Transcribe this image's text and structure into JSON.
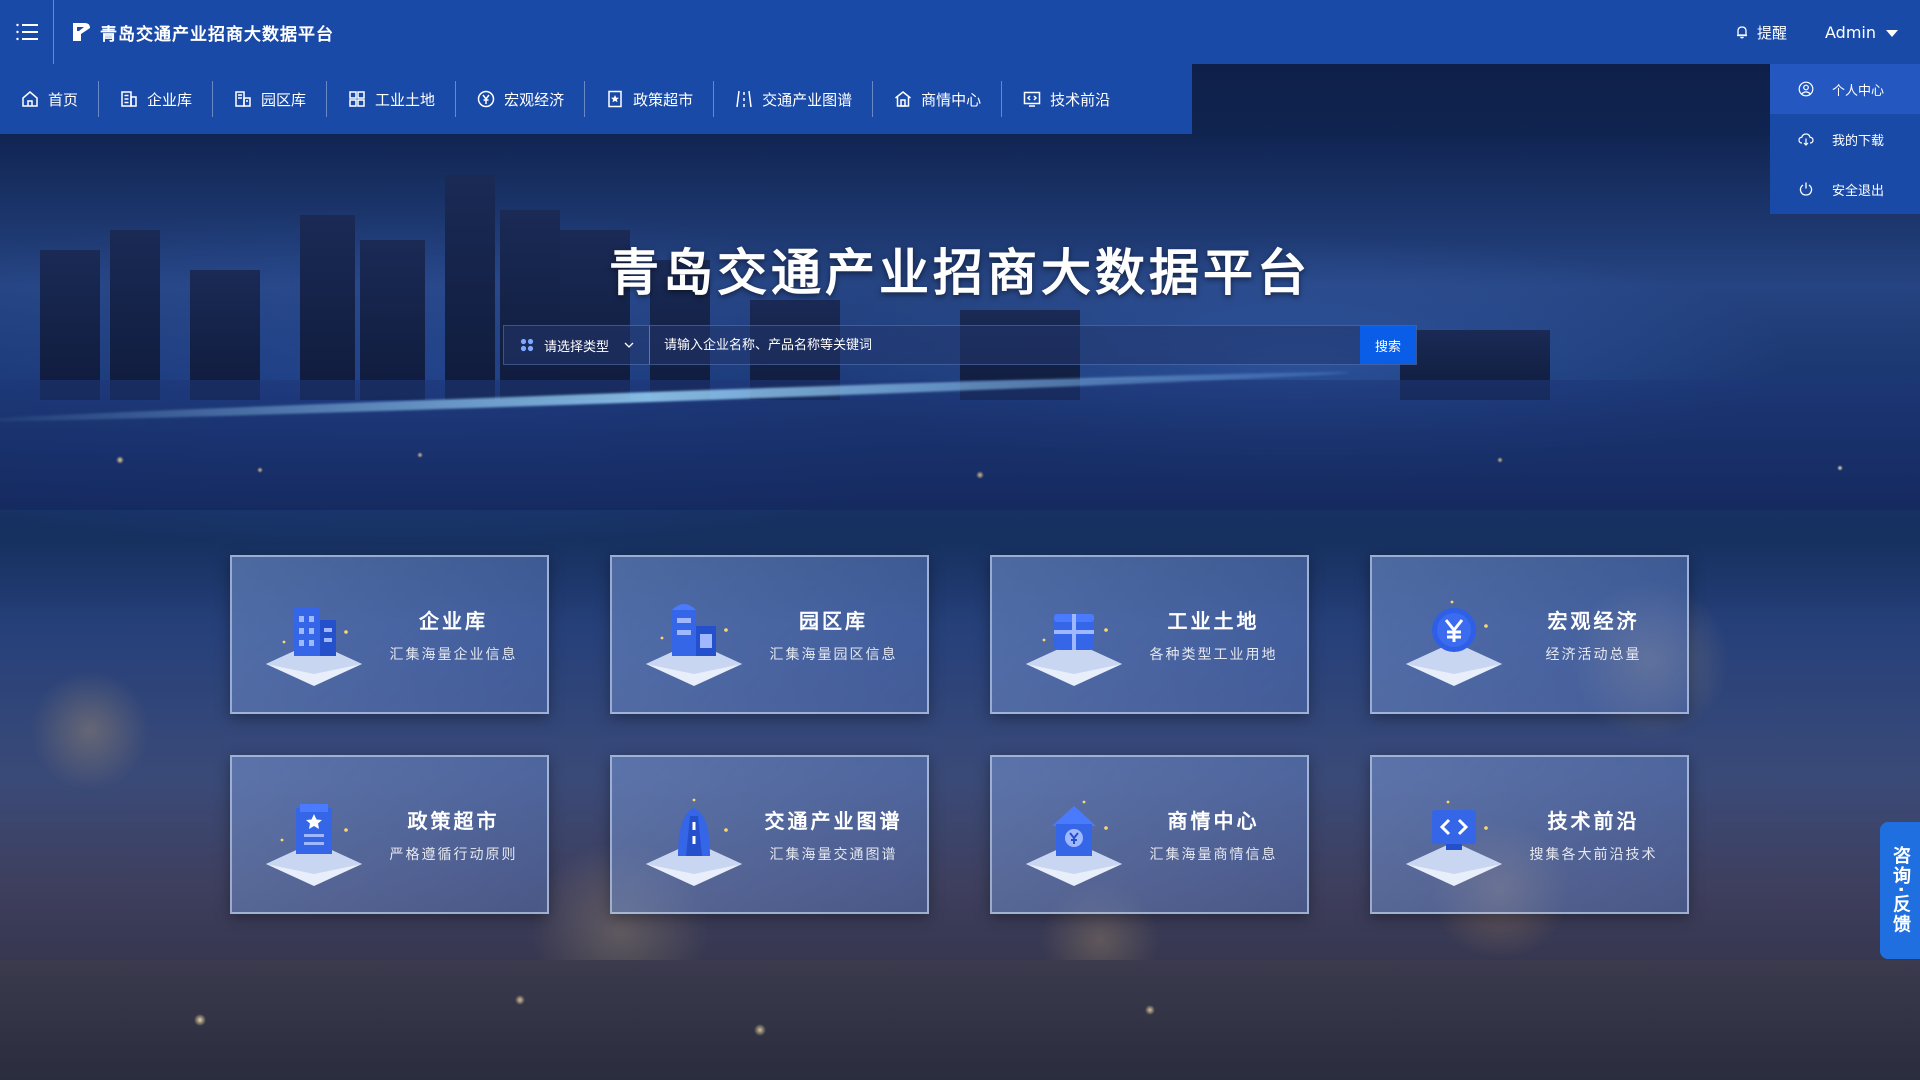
{
  "header": {
    "title": "青岛交通产业招商大数据平台",
    "alert_label": "提醒",
    "user_name": "Admin"
  },
  "nav": {
    "items": [
      {
        "label": "首页",
        "icon": "home-icon"
      },
      {
        "label": "企业库",
        "icon": "building-icon"
      },
      {
        "label": "园区库",
        "icon": "park-icon"
      },
      {
        "label": "工业土地",
        "icon": "grid-icon"
      },
      {
        "label": "宏观经济",
        "icon": "yen-circle-icon"
      },
      {
        "label": "政策超市",
        "icon": "star-doc-icon"
      },
      {
        "label": "交通产业图谱",
        "icon": "road-icon"
      },
      {
        "label": "商情中心",
        "icon": "house-icon"
      },
      {
        "label": "技术前沿",
        "icon": "code-screen-icon"
      }
    ]
  },
  "user_menu": {
    "items": [
      {
        "label": "个人中心",
        "icon": "user-circle-icon"
      },
      {
        "label": "我的下载",
        "icon": "cloud-download-icon"
      },
      {
        "label": "安全退出",
        "icon": "power-icon"
      }
    ]
  },
  "hero": {
    "title": "青岛交通产业招商大数据平台",
    "type_select": "请选择类型",
    "search_placeholder": "请输入企业名称、产品名称等关键词",
    "search_button": "搜索"
  },
  "cards": [
    {
      "title": "企业库",
      "subtitle": "汇集海量企业信息",
      "icon": "enterprise-icon"
    },
    {
      "title": "园区库",
      "subtitle": "汇集海量园区信息",
      "icon": "park-icon"
    },
    {
      "title": "工业土地",
      "subtitle": "各种类型工业用地",
      "icon": "land-icon"
    },
    {
      "title": "宏观经济",
      "subtitle": "经济活动总量",
      "icon": "economy-icon"
    },
    {
      "title": "政策超市",
      "subtitle": "严格遵循行动原则",
      "icon": "policy-icon"
    },
    {
      "title": "交通产业图谱",
      "subtitle": "汇集海量交通图谱",
      "icon": "traffic-icon"
    },
    {
      "title": "商情中心",
      "subtitle": "汇集海量商情信息",
      "icon": "business-icon"
    },
    {
      "title": "技术前沿",
      "subtitle": "搜集各大前沿技术",
      "icon": "tech-icon"
    }
  ],
  "feedback_label": "咨询·反馈",
  "colors": {
    "header_bg": "#1a4aa8",
    "accent": "#0a5de6",
    "feedback_bg": "#1f6fe0"
  }
}
